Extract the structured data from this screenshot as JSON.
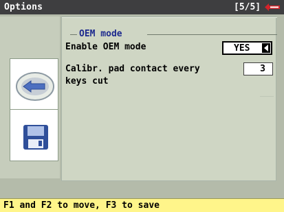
{
  "header": {
    "title": "Options",
    "page_indicator": "[5/5]",
    "logo_icon": "brand-logo-icon"
  },
  "sidebar": {
    "buttons": [
      {
        "name": "back",
        "icon": "back-arrow-icon"
      },
      {
        "name": "save",
        "icon": "floppy-disk-icon"
      }
    ]
  },
  "section": {
    "title": "OEM mode",
    "fields": {
      "enable_oem": {
        "label": "Enable OEM mode",
        "value": "YES"
      },
      "calibration": {
        "label_line1": "Calibr. pad contact every",
        "label_line2": "keys cut",
        "value": "3"
      }
    }
  },
  "status": {
    "text": "F1 and F2 to move, F3 to save"
  },
  "colors": {
    "title_bar": "#3e3e40",
    "background": "#b4bbaa",
    "section_title": "#1d2a8e",
    "status_bar": "#fff58a",
    "logo_red": "#d3232a",
    "accent_blue": "#4d6fc0"
  }
}
